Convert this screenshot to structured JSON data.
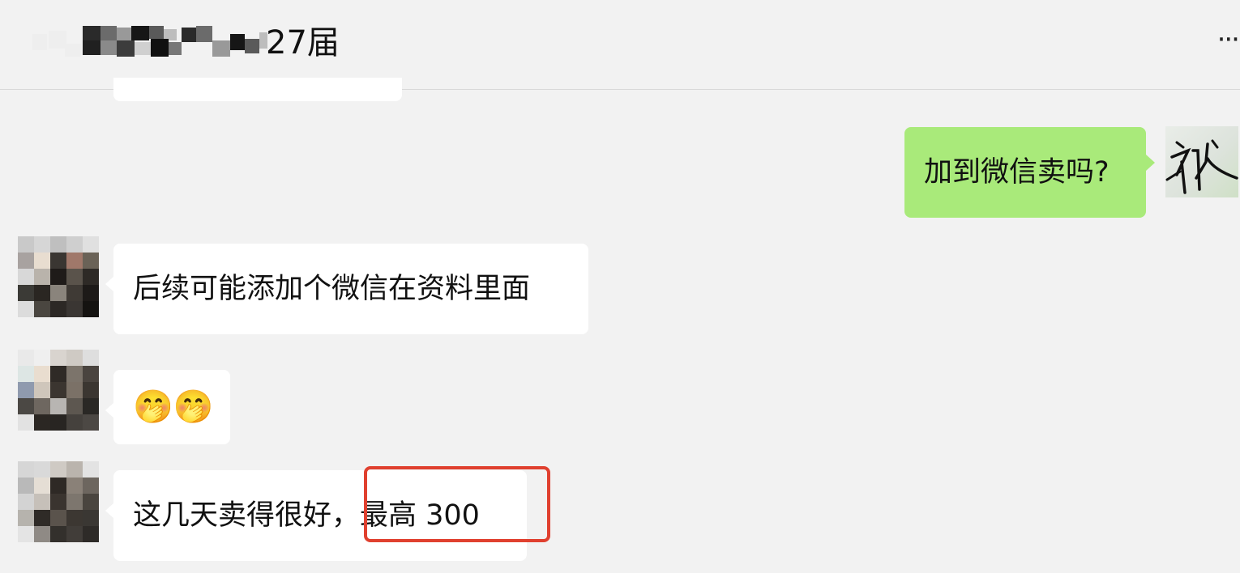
{
  "header": {
    "title_suffix": "27届",
    "more_label": "···",
    "title_mosaic_colors": [
      "#2a2a2a",
      "#6b6b6b",
      "#999999",
      "#161616",
      "#5a5a5a",
      "#bdbdbd",
      "#202020",
      "#8a8a8a",
      "#3c3c3c",
      "#d0d0d0",
      "#111111",
      "#777777"
    ]
  },
  "messages": [
    {
      "id": "m1",
      "side": "out",
      "text": "加到微信卖吗?"
    },
    {
      "id": "m2",
      "side": "in",
      "text": "后续可能添加个微信在资料里面"
    },
    {
      "id": "m3",
      "side": "in",
      "text": "🤭🤭"
    },
    {
      "id": "m4",
      "side": "in",
      "text_before": "这几天卖得很好，",
      "text_highlight": "最高 300"
    }
  ],
  "colors": {
    "outgoing_bubble": "#a9ea7a",
    "incoming_bubble": "#ffffff",
    "background": "#f2f2f2",
    "highlight_border": "#e0402f"
  },
  "icons": {
    "more": "more-dots-icon",
    "avatar_contact": "pixelated-avatar",
    "avatar_self": "handwriting-avatar"
  },
  "avatars": {
    "contact_a": [
      "#c9c9c9",
      "#d6d6d6",
      "#bfbfbf",
      "#cfcfcf",
      "#e0e0e0",
      "#a8a2a0",
      "#e8ddd0",
      "#3a3632",
      "#a0786a",
      "#6a6257",
      "#d8d8d8",
      "#b9b3ab",
      "#1f1b19",
      "#5a534b",
      "#2e2a26",
      "#3b3a36",
      "#2a2622",
      "#8a847c",
      "#3f3a35",
      "#1d1a18",
      "#dcdcdc",
      "#4a4640",
      "#2c2825",
      "#3a3633",
      "#151311"
    ],
    "contact_b": [
      "#e9e9e9",
      "#efefef",
      "#d9d4cf",
      "#cfcac4",
      "#dedede",
      "#dde6e4",
      "#e9ddcf",
      "#2f2a26",
      "#7c746b",
      "#4a443f",
      "#8f9aae",
      "#cfc6bb",
      "#3b3530",
      "#7b7167",
      "#3b3631",
      "#4b4844",
      "#6e6760",
      "#b8b5b2",
      "#5d5750",
      "#2a2825",
      "#e2e2e2",
      "#2b2723",
      "#282522",
      "#45413d",
      "#4c4844"
    ],
    "contact_c": [
      "#d6d6d6",
      "#d9d9d9",
      "#cfcac4",
      "#bab4ad",
      "#e3e3e3",
      "#b9b9b9",
      "#e5ded5",
      "#2e2925",
      "#8a8178",
      "#6d665f",
      "#d3d3d3",
      "#c6c0b9",
      "#3a342f",
      "#7d766e",
      "#4a453f",
      "#b6b3ad",
      "#2f2b27",
      "#5a534c",
      "#3c3732",
      "#3a3733",
      "#e4e4e4",
      "#8f8a85",
      "#33302c",
      "#413d39",
      "#2e2b28"
    ]
  }
}
